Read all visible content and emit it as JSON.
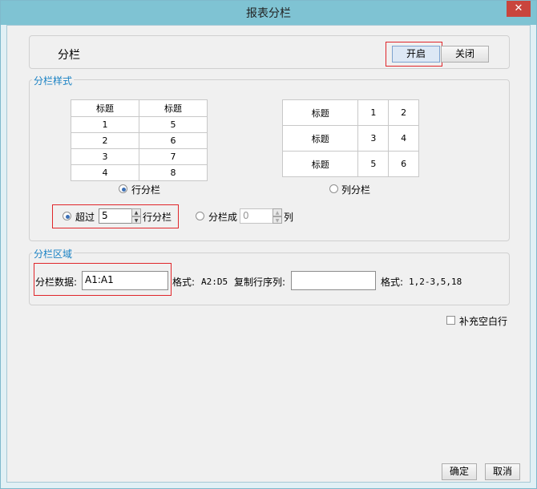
{
  "window": {
    "title": "报表分栏",
    "close_glyph": "✕"
  },
  "header": {
    "label": "分栏",
    "on_label": "开启",
    "off_label": "关闭"
  },
  "style_section": {
    "legend": "分栏样式",
    "row_preview": {
      "headers": [
        "标题",
        "标题"
      ],
      "rows": [
        [
          "1",
          "5"
        ],
        [
          "2",
          "6"
        ],
        [
          "3",
          "7"
        ],
        [
          "4",
          "8"
        ]
      ]
    },
    "col_preview": {
      "rows": [
        [
          "标题",
          "1",
          "2"
        ],
        [
          "标题",
          "3",
          "4"
        ],
        [
          "标题",
          "5",
          "6"
        ]
      ]
    },
    "row_radio_label": "行分栏",
    "col_radio_label": "列分栏",
    "row_mode_selected": true,
    "exceed_label": "超过",
    "exceed_value": "5",
    "exceed_suffix": "行分栏",
    "split_into_label": "分栏成",
    "split_into_value": "0",
    "split_into_suffix": "列"
  },
  "area_section": {
    "legend": "分栏区域",
    "data_label": "分栏数据:",
    "data_value": "A1:A1",
    "format_label": "格式:",
    "format_example": "A2:D5",
    "copy_rows_label": "复制行序列:",
    "copy_rows_value": "",
    "format_label2": "格式:",
    "copy_rows_example": "1,2-3,5,18"
  },
  "fill_blank_label": "补充空白行",
  "footer": {
    "ok_label": "确定",
    "cancel_label": "取消"
  }
}
